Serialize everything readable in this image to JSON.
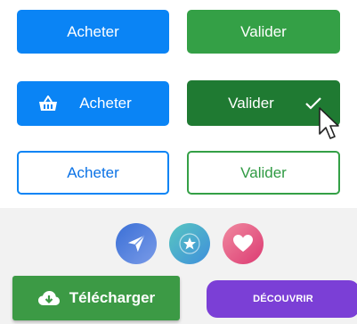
{
  "buttons": {
    "buy_label": "Acheter",
    "validate_label": "Valider",
    "download_label": "Télécharger",
    "discover_label": "DÉCOUVRIR"
  },
  "colors": {
    "primary_blue": "#0a84f5",
    "success_green": "#34a046",
    "success_green_active": "#1f7a32",
    "download_green": "#3c9a45",
    "discover_purple": "#7b3fd6"
  },
  "icons": {
    "buy_icon": "basket-icon",
    "validate_icon": "check-icon",
    "circle_1": "send-icon",
    "circle_2": "star-icon",
    "circle_3": "heart-icon",
    "download_icon": "cloud-download-icon",
    "pointer": "mouse-cursor-icon"
  }
}
